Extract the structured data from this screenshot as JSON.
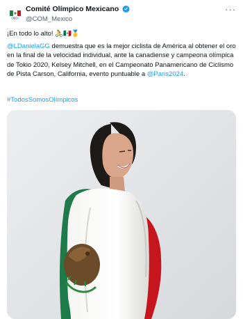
{
  "account": {
    "name": "Comité Olímpico Mexicano",
    "handle": "@COM_Mexico"
  },
  "header": {
    "more_label": "···"
  },
  "tweet": {
    "line1": "¡En todo lo alto! 🚴🇲🇽🥇",
    "mention_cyclist": "@LDanielaGG",
    "body": " demuestra que es la mejor ciclista de América al obtener el oro en la final de la velocidad individual, ante la canadiense y campeona olímpica de Tokio 2020, Kelsey  Mitchell, en el Campeonato Panamericano de Ciclismo de Pista Carson, California, evento puntuable a ",
    "mention_paris": "@Paris2024",
    "end": ".",
    "hashtag": "#TodosSomosOlímpicos"
  },
  "colors": {
    "link": "#1d9bf0",
    "verified": "#1d9bf0",
    "flag_green": "#1f7a4a",
    "flag_red": "#c4161c"
  }
}
